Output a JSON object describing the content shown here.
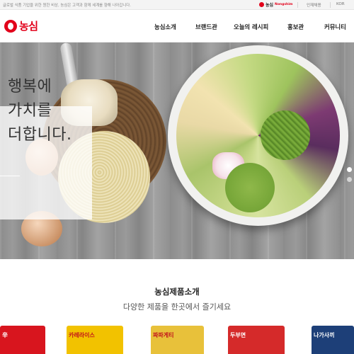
{
  "topbar": {
    "notice": "글로벌 식품 기업을 위한 원한 비상, 농심은 고객과 함께 세계를 향해 나아갑니다.",
    "mini_logo_brand": "농심",
    "mini_logo_sub": "Nongshim",
    "links": [
      "인재채용",
      "KOR"
    ]
  },
  "header": {
    "logo_text": "농심",
    "nav": [
      "농심소개",
      "브랜드관",
      "오늘의 레시피",
      "홍보관",
      "커뮤니티"
    ]
  },
  "hero": {
    "tagline": [
      "행복에",
      "가치를",
      "더합니다."
    ],
    "slides_total": 2,
    "slide_active": 1
  },
  "products": {
    "title": "농심제품소개",
    "subtitle": "다양한 제품을 한곳에서 즐기세요",
    "packages": [
      {
        "label": "辛",
        "color": "#d8151e"
      },
      {
        "label": "카레라이스",
        "color": "#f2c200"
      },
      {
        "label": "짜파게티",
        "color": "#e8c13a"
      },
      {
        "label": "두부면",
        "color": "#d52a2a"
      },
      {
        "label": "나가사끼",
        "color": "#1d3f78"
      }
    ]
  },
  "colors": {
    "brand_red": "#e2001a",
    "text_dark": "#222222"
  }
}
